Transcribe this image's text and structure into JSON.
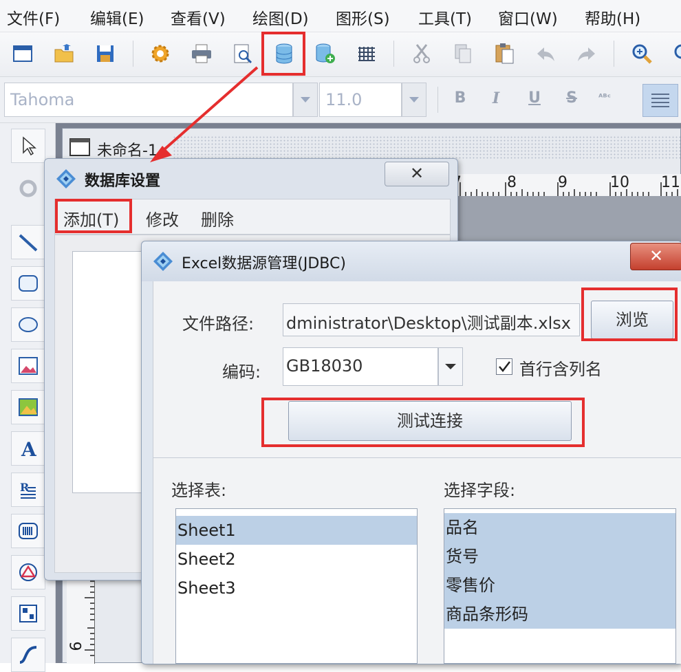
{
  "menu": {
    "items": [
      "文件(F)",
      "编辑(E)",
      "查看(V)",
      "绘图(D)",
      "图形(S)",
      "工具(T)",
      "窗口(W)",
      "帮助(H)"
    ]
  },
  "toolbar": {
    "icons": [
      "window-icon",
      "open-icon",
      "save-icon",
      "settings-gear-icon",
      "print-icon",
      "print-preview-icon",
      "database-icon",
      "database-add-icon",
      "grid-icon",
      "cut-icon",
      "copy-icon",
      "paste-icon",
      "undo-icon",
      "redo-icon",
      "zoom-in-icon"
    ]
  },
  "format": {
    "font_name": "Tahoma",
    "font_size": "11.0",
    "bold": "B",
    "italic": "I",
    "underline": "U",
    "strike": "S"
  },
  "document": {
    "title": "未命名-1"
  },
  "ruler": {
    "labels": [
      "7",
      "8",
      "9",
      "10",
      "11"
    ]
  },
  "vruler": {
    "labels": [
      "8",
      "9"
    ]
  },
  "db_dialog": {
    "title": "数据库设置",
    "close": "✕",
    "menu": [
      "添加(T)",
      "修改",
      "删除"
    ]
  },
  "excel_dialog": {
    "title": "Excel数据源管理(JDBC)",
    "close": "✕",
    "file_path_label": "文件路径:",
    "file_path_value": "dministrator\\Desktop\\测试副本.xlsx",
    "browse_label": "浏览",
    "encoding_label": "编码:",
    "encoding_value": "GB18030",
    "header_checkbox_label": "首行含列名",
    "header_checkbox_checked": true,
    "test_button": "测试连接",
    "select_table_label": "选择表:",
    "tables": [
      "Sheet1",
      "Sheet2",
      "Sheet3"
    ],
    "selected_table": "Sheet1",
    "select_field_label": "选择字段:",
    "fields": [
      "品名",
      "货号",
      "零售价",
      "商品条形码"
    ]
  },
  "colors": {
    "highlight": "#e52e2e",
    "selection": "#bcd0e6",
    "close_red": "#c4402e"
  }
}
